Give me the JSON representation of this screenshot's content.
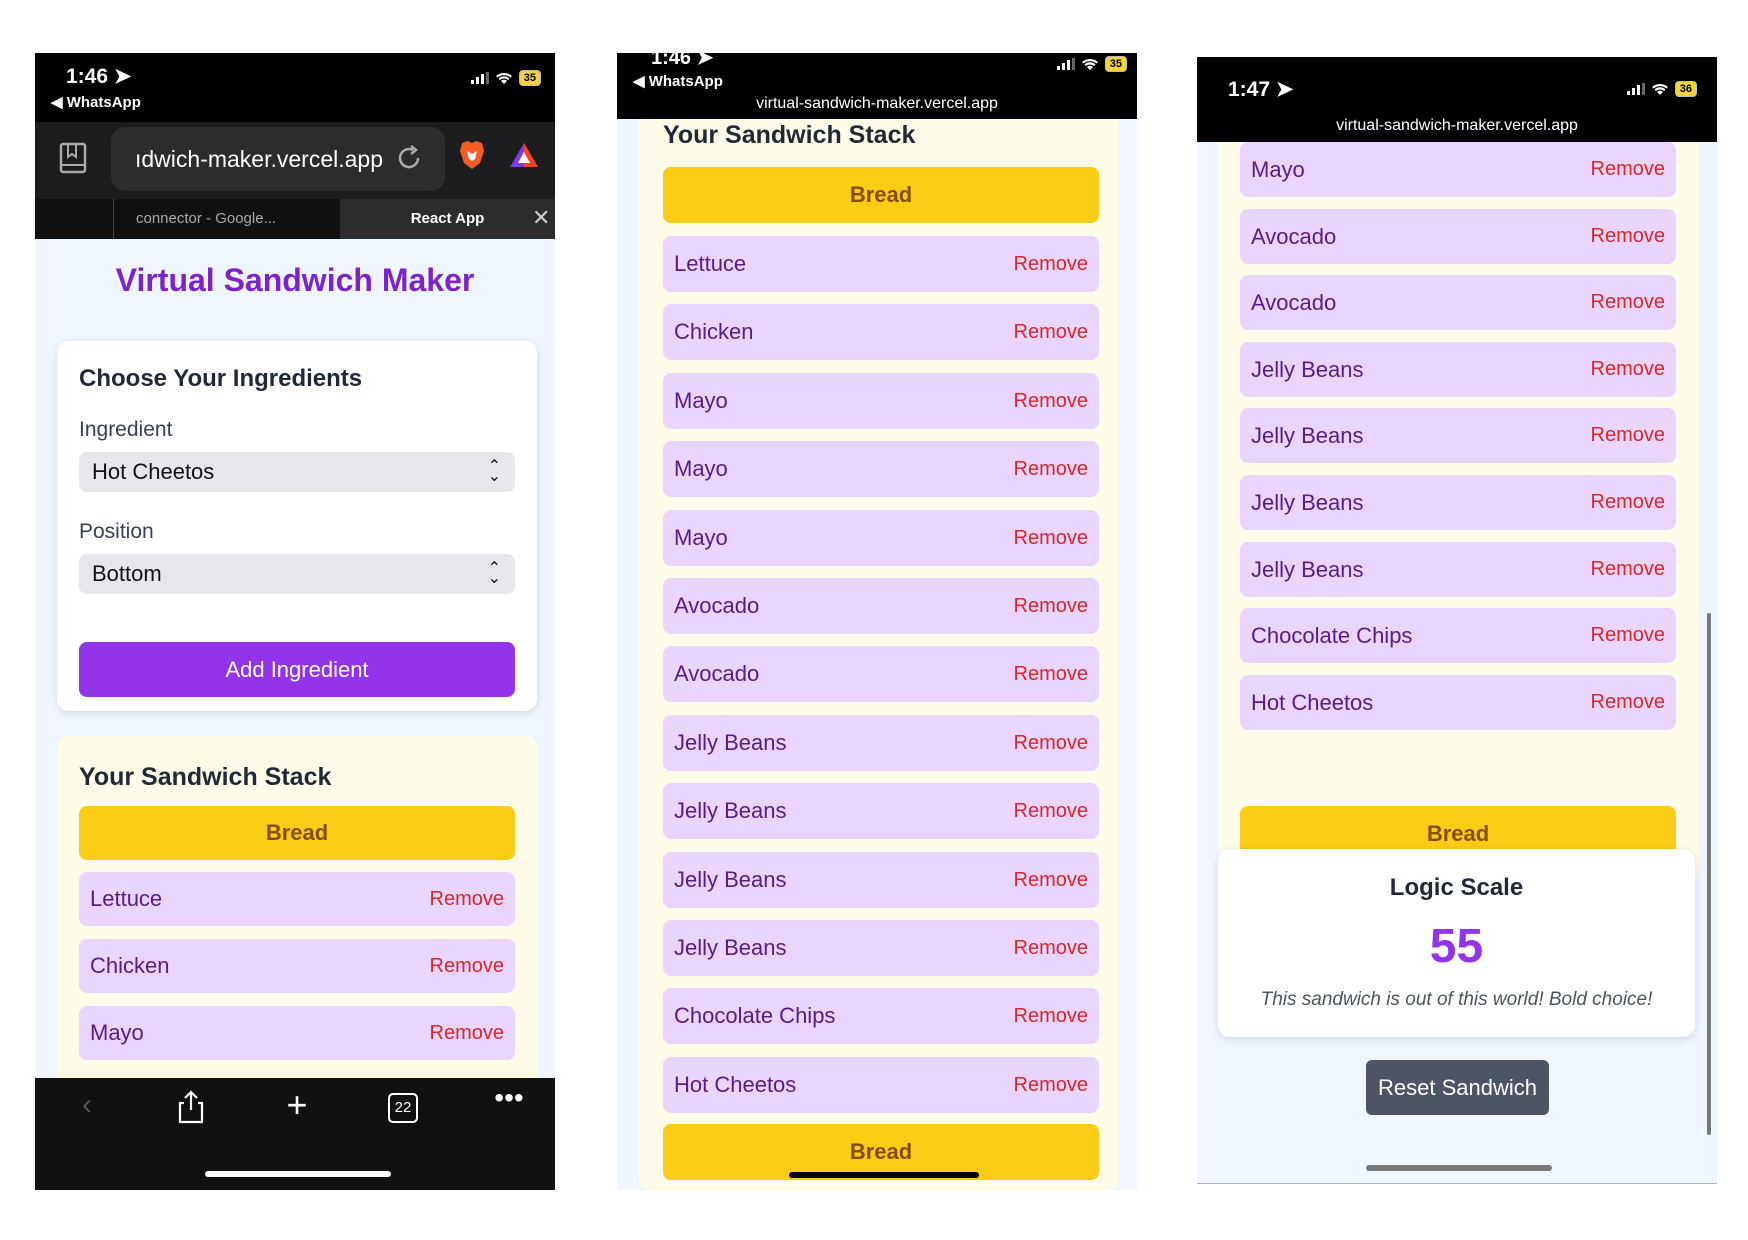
{
  "phone1": {
    "time": "1:46",
    "back_app": "◀ WhatsApp",
    "battery": "35",
    "url": "ıdwich-maker.vercel.app",
    "tabs": {
      "tab1": "connector - Google...",
      "tab2": "React App"
    },
    "app_title": "Virtual Sandwich Maker",
    "form": {
      "heading": "Choose Your Ingredients",
      "ingredient_label": "Ingredient",
      "ingredient_value": "Hot Cheetos",
      "position_label": "Position",
      "position_value": "Bottom",
      "add_button": "Add Ingredient"
    },
    "stack_title": "Your Sandwich Stack",
    "bread": "Bread",
    "items": [
      "Lettuce",
      "Chicken",
      "Mayo"
    ],
    "remove_label": "Remove",
    "tab_count": "22"
  },
  "phone2": {
    "time": "1:46",
    "back_app": "◀ WhatsApp",
    "battery": "35",
    "url": "virtual-sandwich-maker.vercel.app",
    "stack_title": "Your Sandwich Stack",
    "bread_top": "Bread",
    "bread_bottom": "Bread",
    "remove_label": "Remove",
    "items": [
      "Lettuce",
      "Chicken",
      "Mayo",
      "Mayo",
      "Mayo",
      "Avocado",
      "Avocado",
      "Jelly Beans",
      "Jelly Beans",
      "Jelly Beans",
      "Jelly Beans",
      "Chocolate Chips",
      "Hot Cheetos"
    ]
  },
  "phone3": {
    "time": "1:47",
    "battery": "36",
    "url": "virtual-sandwich-maker.vercel.app",
    "remove_label": "Remove",
    "items": [
      "Mayo",
      "Avocado",
      "Avocado",
      "Jelly Beans",
      "Jelly Beans",
      "Jelly Beans",
      "Jelly Beans",
      "Chocolate Chips",
      "Hot Cheetos"
    ],
    "bread_bottom": "Bread",
    "logic": {
      "title": "Logic Scale",
      "score": "55",
      "message": "This sandwich is out of this world! Bold choice!"
    },
    "reset_button": "Reset Sandwich"
  },
  "colors": {
    "title_purple": "#7e22ce",
    "button_purple": "#9333ea",
    "bread_yellow": "#facc15",
    "ingredient_bg": "#e9d5ff",
    "remove_red": "#dc2626",
    "page_bg": "#eff6ff"
  }
}
